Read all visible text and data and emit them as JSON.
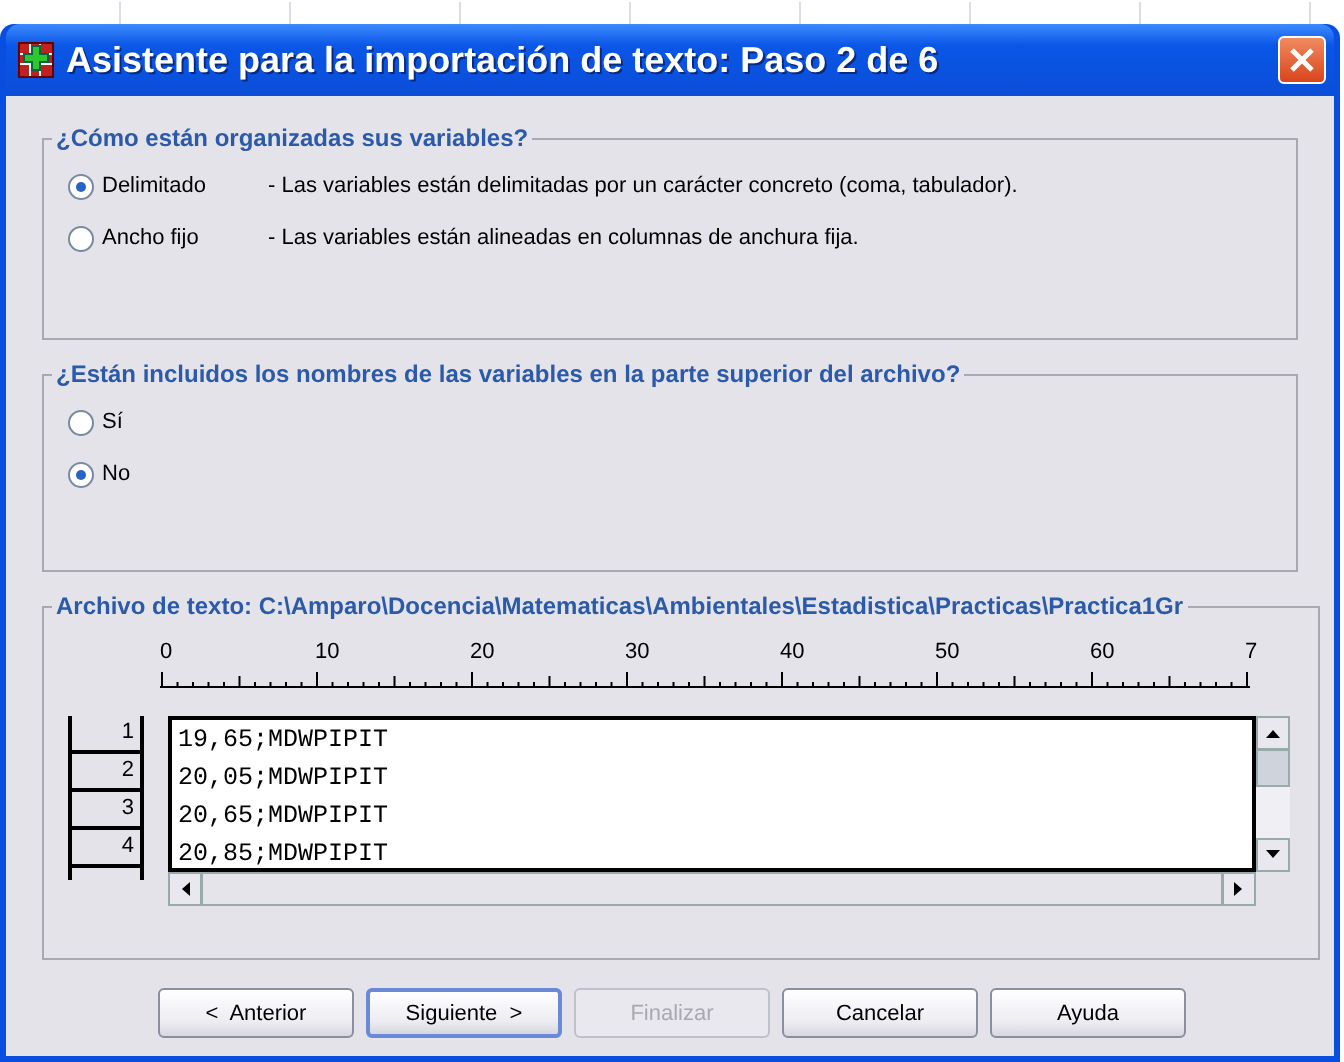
{
  "window": {
    "title": "Asistente para la importación de texto: Paso 2 de 6"
  },
  "organization": {
    "legend": "¿Cómo están organizadas sus variables?",
    "options": [
      {
        "label": "Delimitado",
        "description": "- Las variables están delimitadas por un carácter concreto (coma, tabulador).",
        "selected": true
      },
      {
        "label": "Ancho fijo",
        "description": "- Las variables están alineadas en columnas de anchura fija.",
        "selected": false
      }
    ]
  },
  "header_names": {
    "legend": "¿Están incluidos los nombres de las variables en la parte superior del archivo?",
    "options": [
      {
        "label": "Sí",
        "selected": false
      },
      {
        "label": "No",
        "selected": true
      }
    ]
  },
  "preview": {
    "legend": "Archivo de texto:  C:\\Amparo\\Docencia\\Matematicas\\Ambientales\\Estadistica\\Practicas\\Practica1Gr",
    "ruler_labels": [
      "0",
      "10",
      "20",
      "30",
      "40",
      "50",
      "60",
      "7"
    ],
    "rows": [
      {
        "number": "1",
        "text": "19,65;MDWPIPIT"
      },
      {
        "number": "2",
        "text": "20,05;MDWPIPIT"
      },
      {
        "number": "3",
        "text": "20,65;MDWPIPIT"
      },
      {
        "number": "4",
        "text": "20,85;MDWPIPIT"
      }
    ]
  },
  "buttons": [
    {
      "label": "<  Anterior",
      "disabled": false,
      "default": false
    },
    {
      "label": "Siguiente  >",
      "disabled": false,
      "default": true
    },
    {
      "label": "Finalizar",
      "disabled": true,
      "default": false
    },
    {
      "label": "Cancelar",
      "disabled": false,
      "default": false
    },
    {
      "label": "Ayuda",
      "disabled": false,
      "default": false
    }
  ]
}
